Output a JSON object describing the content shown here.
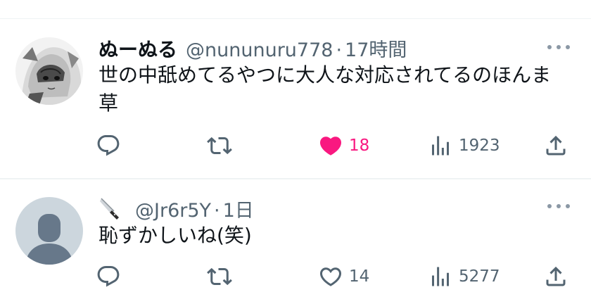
{
  "tweets": [
    {
      "name": "ぬーぬる",
      "handle": "@nununuru778",
      "separator": "·",
      "time": "17時間",
      "text": "世の中舐めてるやつに大人な対応されてるのほんま草",
      "liked": true,
      "actions": {
        "reply_icon": "reply-icon",
        "retweet_icon": "retweet-icon",
        "like_count": "18",
        "views": "1923",
        "share_icon": "share-icon"
      },
      "avatar": "anime-girl-avatar"
    },
    {
      "name_icon": "knife-icon",
      "handle": "@Jr6r5Y",
      "separator": "·",
      "time": "1日",
      "text": "恥ずかしいね(笑)",
      "liked": false,
      "actions": {
        "reply_icon": "reply-icon",
        "retweet_icon": "retweet-icon",
        "like_count": "14",
        "views": "5277",
        "share_icon": "share-icon"
      },
      "avatar": "default-avatar"
    }
  ],
  "colors": {
    "text": "#0f1419",
    "muted": "#536471",
    "like": "#f91880",
    "border": "#eff3f4",
    "default_avatar_bg": "#ccd6dd",
    "default_avatar_fg": "#67788a"
  }
}
